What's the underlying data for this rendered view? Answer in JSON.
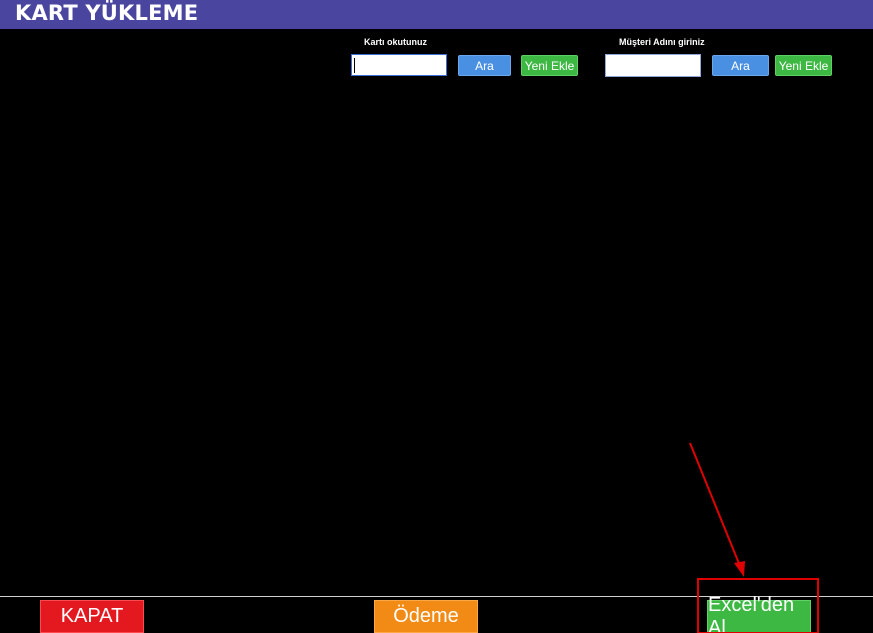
{
  "window": {
    "title": "KART YÜKLEME"
  },
  "card_search": {
    "label": "Kartı okutunuz",
    "value": "",
    "search_label": "Ara",
    "add_label": "Yeni Ekle"
  },
  "customer_search": {
    "label": "Müşteri Adını giriniz",
    "value": "",
    "search_label": "Ara",
    "add_label": "Yeni Ekle"
  },
  "footer": {
    "close_label": "KAPAT",
    "payment_label": "Ödeme",
    "excel_label": "Excel'den Al"
  },
  "colors": {
    "title_bar": "#4a46a0",
    "background": "#000000",
    "blue_button": "#4a90e2",
    "green_button": "#3db843",
    "red_button": "#e4191f",
    "orange_button": "#f28a16",
    "annotation": "#e00000"
  }
}
